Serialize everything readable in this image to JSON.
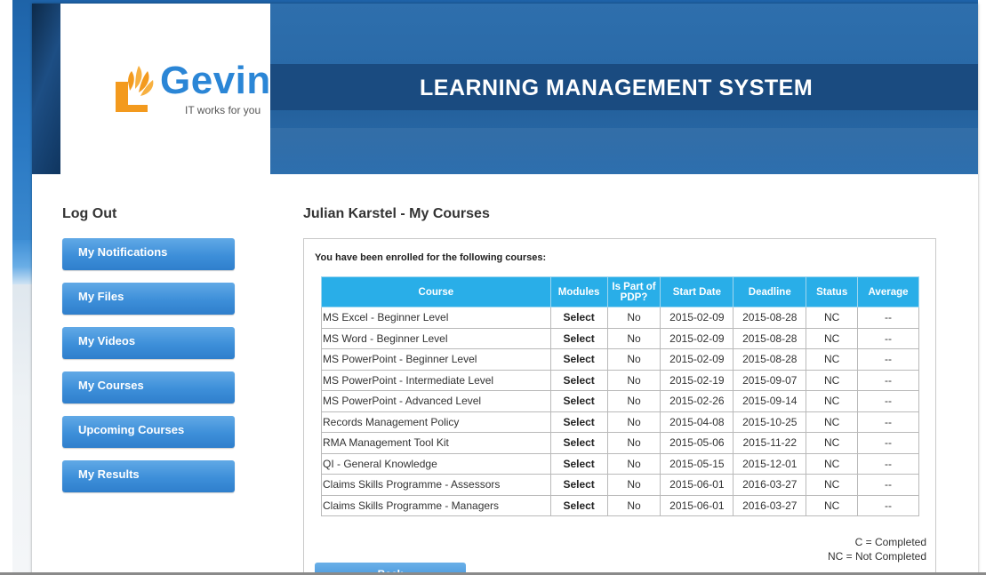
{
  "brand": {
    "logo_name": "Gevin",
    "tagline": "IT works for you",
    "system_title": "LEARNING MANAGEMENT SYSTEM"
  },
  "sidebar": {
    "logout_label": "Log Out",
    "items": [
      {
        "label": "My Notifications"
      },
      {
        "label": "My Files"
      },
      {
        "label": "My Videos"
      },
      {
        "label": "My Courses"
      },
      {
        "label": "Upcoming Courses"
      },
      {
        "label": "My Results"
      }
    ]
  },
  "main": {
    "title": "Julian Karstel - My Courses",
    "intro": "You have been enrolled for the following courses:",
    "columns": [
      "Course",
      "Modules",
      "Is Part of PDP?",
      "Start Date",
      "Deadline",
      "Status",
      "Average"
    ],
    "rows": [
      {
        "course": "MS Excel - Beginner Level",
        "modules": "Select",
        "pdp": "No",
        "start": "2015-02-09",
        "deadline": "2015-08-28",
        "status": "NC",
        "average": "--"
      },
      {
        "course": "MS Word - Beginner Level",
        "modules": "Select",
        "pdp": "No",
        "start": "2015-02-09",
        "deadline": "2015-08-28",
        "status": "NC",
        "average": "--"
      },
      {
        "course": "MS PowerPoint - Beginner Level",
        "modules": "Select",
        "pdp": "No",
        "start": "2015-02-09",
        "deadline": "2015-08-28",
        "status": "NC",
        "average": "--"
      },
      {
        "course": "MS PowerPoint - Intermediate Level",
        "modules": "Select",
        "pdp": "No",
        "start": "2015-02-19",
        "deadline": "2015-09-07",
        "status": "NC",
        "average": "--"
      },
      {
        "course": "MS PowerPoint - Advanced Level",
        "modules": "Select",
        "pdp": "No",
        "start": "2015-02-26",
        "deadline": "2015-09-14",
        "status": "NC",
        "average": "--"
      },
      {
        "course": "Records Management Policy",
        "modules": "Select",
        "pdp": "No",
        "start": "2015-04-08",
        "deadline": "2015-10-25",
        "status": "NC",
        "average": "--"
      },
      {
        "course": "RMA Management Tool Kit",
        "modules": "Select",
        "pdp": "No",
        "start": "2015-05-06",
        "deadline": "2015-11-22",
        "status": "NC",
        "average": "--"
      },
      {
        "course": "QI - General Knowledge",
        "modules": "Select",
        "pdp": "No",
        "start": "2015-05-15",
        "deadline": "2015-12-01",
        "status": "NC",
        "average": "--"
      },
      {
        "course": "Claims Skills Programme - Assessors",
        "modules": "Select",
        "pdp": "No",
        "start": "2015-06-01",
        "deadline": "2016-03-27",
        "status": "NC",
        "average": "--"
      },
      {
        "course": "Claims Skills Programme - Managers",
        "modules": "Select",
        "pdp": "No",
        "start": "2015-06-01",
        "deadline": "2016-03-27",
        "status": "NC",
        "average": "--"
      }
    ],
    "legend": {
      "completed": "C = Completed",
      "not_completed": "NC = Not Completed"
    },
    "back_label": "Back"
  },
  "colors": {
    "banner": "#2a6aa8",
    "banner_bar": "#1a4b80",
    "nav_button": "#3d8fd9",
    "table_header": "#29aee8",
    "logo_blue": "#2b86d6",
    "logo_orange": "#f39a1e"
  }
}
